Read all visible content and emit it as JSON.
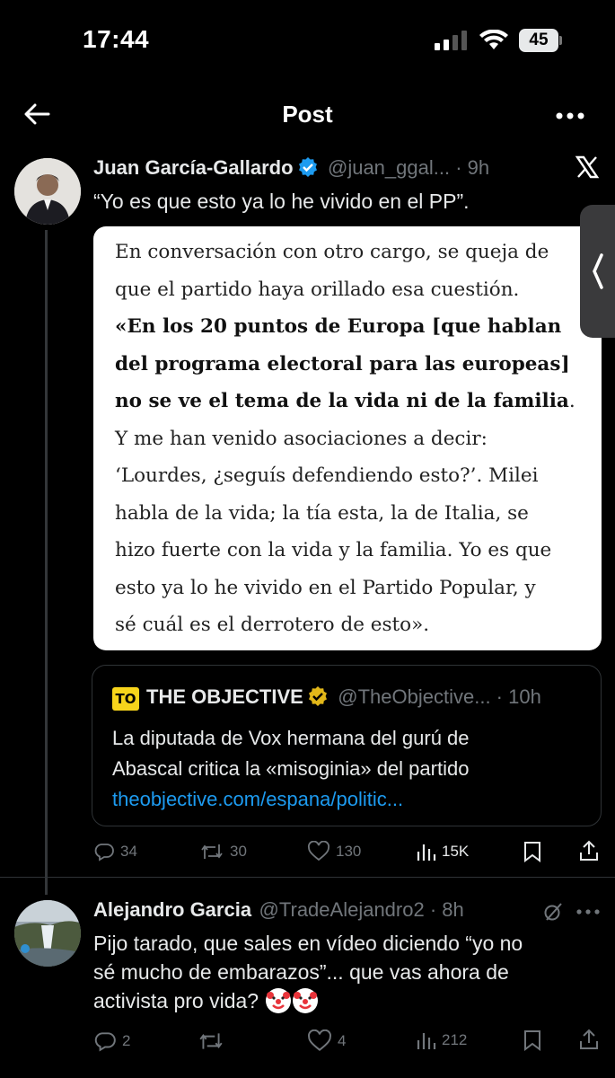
{
  "status_bar": {
    "time": "17:44",
    "battery": "45"
  },
  "header": {
    "title": "Post"
  },
  "tweet1": {
    "name": "Juan García-Gallardo",
    "handle_time": "@juan_ggal... · 9h",
    "text": "“Yo es que esto ya lo he vivido en el PP”.",
    "image_article": {
      "line1": "En conversación con otro cargo, se queja de",
      "line2": "que el partido haya orillado esa cuestión.",
      "bold1": "«En los 20 puntos de Europa [que hablan",
      "bold2": "del programa electoral para las europeas]",
      "bold3": "no se ve el tema de la vida ni de la familia",
      "bold3_end": ".",
      "line6": "Y me han venido asociaciones a decir:",
      "line7": "‘Lourdes, ¿seguís defendiendo esto?’. Milei",
      "line8": "habla de la vida; la tía esta, la de Italia, se",
      "line9": "hizo fuerte con la vida y la familia. Yo es que",
      "line10": "esto ya lo he vivido en el Partido Popular, y",
      "line11": "sé cuál es el derrotero de esto»."
    },
    "quote": {
      "logo": "TO",
      "name": "THE OBJECTIVE",
      "handle_time": "@TheObjective... · 10h",
      "line1": "La diputada de Vox hermana del gurú de",
      "line2": "Abascal critica la «misoginia» del partido",
      "link": "theobjective.com/espana/politic..."
    },
    "actions": {
      "replies": "34",
      "reposts": "30",
      "likes": "130",
      "views": "15K"
    }
  },
  "tweet2": {
    "name": "Alejandro Garcia",
    "handle_time": "@TradeAlejandro2 · 8h",
    "line1": "Pijo tarado, que sales en vídeo diciendo “yo no",
    "line2": "sé mucho de embarazos”... que vas ahora de",
    "line3": "activista pro vida?",
    "actions": {
      "replies": "2",
      "reposts": "",
      "likes": "4",
      "views": "212"
    }
  },
  "icons": [
    "back-arrow-icon",
    "more-icon",
    "x-logo-icon",
    "verified-icon",
    "reply-icon",
    "repost-icon",
    "like-icon",
    "views-icon",
    "bookmark-icon",
    "share-icon",
    "grok-icon",
    "clown-emoji-icon"
  ],
  "colors": {
    "background": "#000000",
    "text": "#e7e9ea",
    "muted": "#71767b",
    "link": "#1d9bf0",
    "verified_gold": "#e2b719",
    "verified_blue": "#1d9bf0"
  }
}
